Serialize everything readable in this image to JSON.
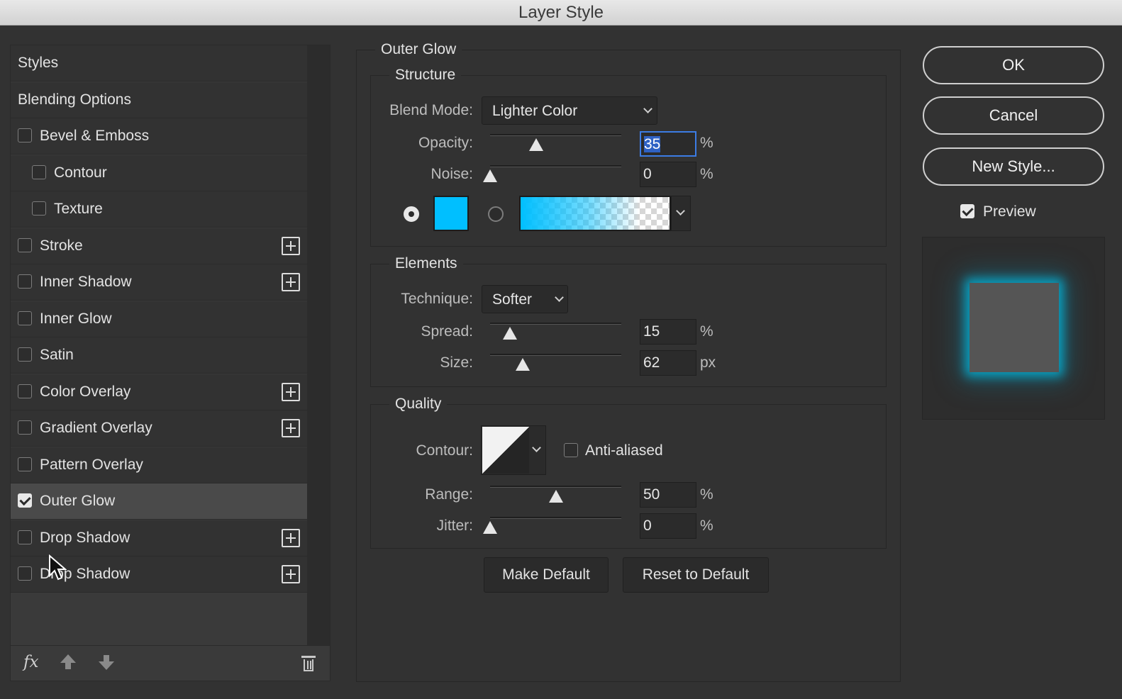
{
  "window": {
    "title": "Layer Style"
  },
  "styles_list": {
    "items": [
      {
        "label": "Styles",
        "has_checkbox": false,
        "checked": false,
        "indent": false,
        "has_plus": false,
        "active": false
      },
      {
        "label": "Blending Options",
        "has_checkbox": false,
        "checked": false,
        "indent": false,
        "has_plus": false,
        "active": false
      },
      {
        "label": "Bevel & Emboss",
        "has_checkbox": true,
        "checked": false,
        "indent": false,
        "has_plus": false,
        "active": false
      },
      {
        "label": "Contour",
        "has_checkbox": true,
        "checked": false,
        "indent": true,
        "has_plus": false,
        "active": false
      },
      {
        "label": "Texture",
        "has_checkbox": true,
        "checked": false,
        "indent": true,
        "has_plus": false,
        "active": false
      },
      {
        "label": "Stroke",
        "has_checkbox": true,
        "checked": false,
        "indent": false,
        "has_plus": true,
        "active": false
      },
      {
        "label": "Inner Shadow",
        "has_checkbox": true,
        "checked": false,
        "indent": false,
        "has_plus": true,
        "active": false
      },
      {
        "label": "Inner Glow",
        "has_checkbox": true,
        "checked": false,
        "indent": false,
        "has_plus": false,
        "active": false
      },
      {
        "label": "Satin",
        "has_checkbox": true,
        "checked": false,
        "indent": false,
        "has_plus": false,
        "active": false
      },
      {
        "label": "Color Overlay",
        "has_checkbox": true,
        "checked": false,
        "indent": false,
        "has_plus": true,
        "active": false
      },
      {
        "label": "Gradient Overlay",
        "has_checkbox": true,
        "checked": false,
        "indent": false,
        "has_plus": true,
        "active": false
      },
      {
        "label": "Pattern Overlay",
        "has_checkbox": true,
        "checked": false,
        "indent": false,
        "has_plus": false,
        "active": false
      },
      {
        "label": "Outer Glow",
        "has_checkbox": true,
        "checked": true,
        "indent": false,
        "has_plus": false,
        "active": true
      },
      {
        "label": "Drop Shadow",
        "has_checkbox": true,
        "checked": false,
        "indent": false,
        "has_plus": true,
        "active": false
      },
      {
        "label": "Drop Shadow",
        "has_checkbox": true,
        "checked": false,
        "indent": false,
        "has_plus": true,
        "active": false
      }
    ],
    "footer": {
      "fx_label": "fx"
    }
  },
  "outer_glow": {
    "section_title": "Outer Glow",
    "structure": {
      "title": "Structure",
      "blend_mode_label": "Blend Mode:",
      "blend_mode_value": "Lighter Color",
      "opacity_label": "Opacity:",
      "opacity_value": "35",
      "opacity_unit": "%",
      "opacity_level": 0.35,
      "noise_label": "Noise:",
      "noise_value": "0",
      "noise_unit": "%",
      "noise_level": 0.0,
      "glow_source": "solid-color",
      "glow_color": "#00BFFF"
    },
    "elements": {
      "title": "Elements",
      "technique_label": "Technique:",
      "technique_value": "Softer",
      "spread_label": "Spread:",
      "spread_value": "15",
      "spread_unit": "%",
      "spread_level": 0.15,
      "size_label": "Size:",
      "size_value": "62",
      "size_unit": "px",
      "size_level": 0.25
    },
    "quality": {
      "title": "Quality",
      "contour_label": "Contour:",
      "anti_aliased_label": "Anti-aliased",
      "anti_aliased": false,
      "range_label": "Range:",
      "range_value": "50",
      "range_unit": "%",
      "range_level": 0.5,
      "jitter_label": "Jitter:",
      "jitter_value": "0",
      "jitter_unit": "%",
      "jitter_level": 0.0
    },
    "make_default_label": "Make Default",
    "reset_default_label": "Reset to Default"
  },
  "actions": {
    "ok_label": "OK",
    "cancel_label": "Cancel",
    "new_style_label": "New Style...",
    "preview_label": "Preview",
    "preview_checked": true
  },
  "colors": {
    "glow": "#00BFFF",
    "panel_bg": "#323232",
    "selection": "#2F62C4"
  }
}
